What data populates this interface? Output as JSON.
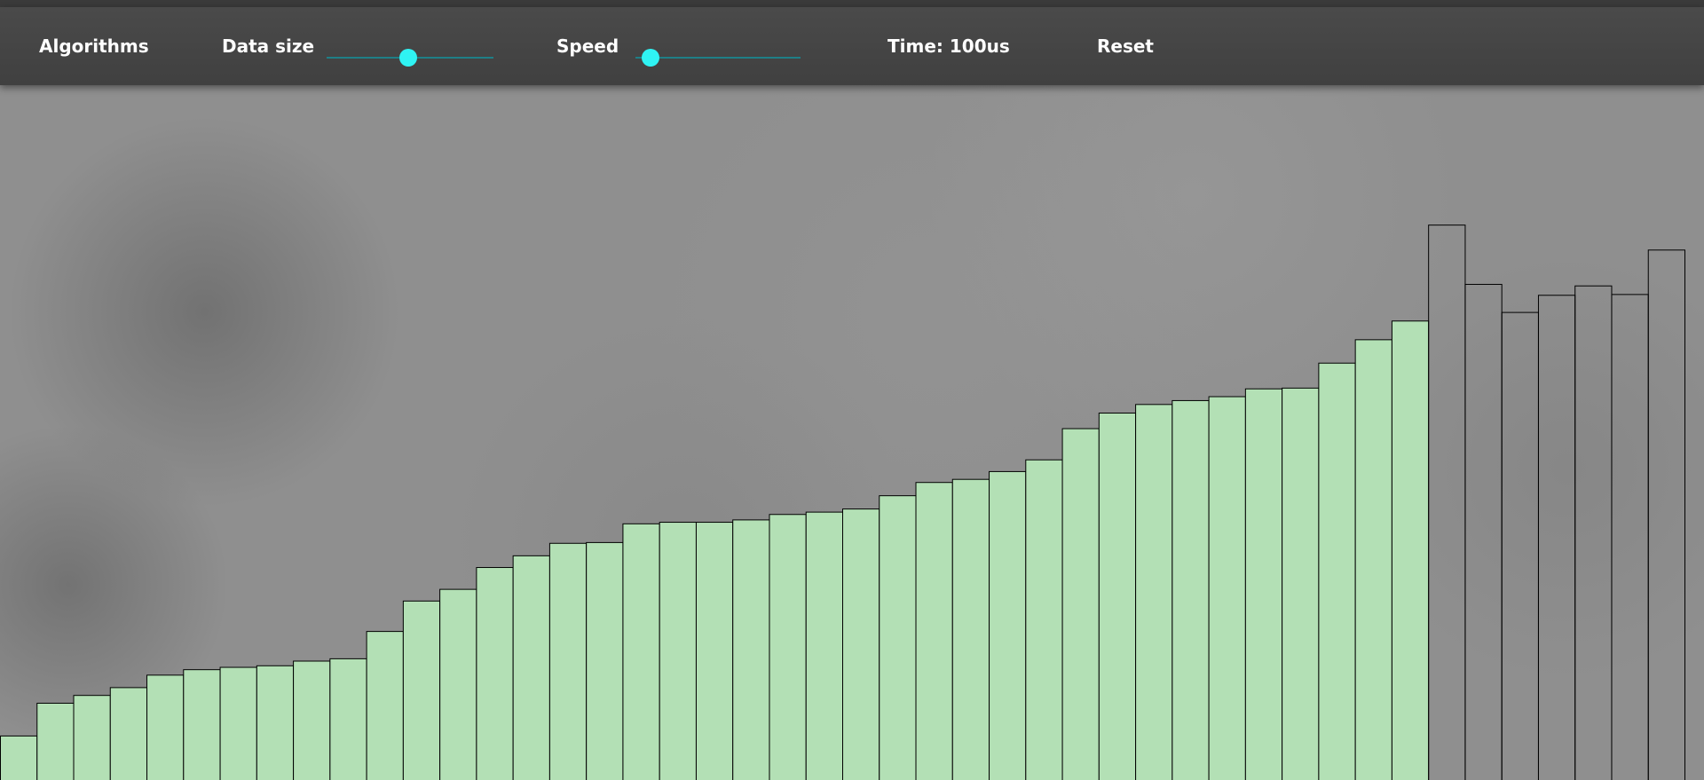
{
  "navbar": {
    "algorithms_label": "Algorithms",
    "data_size_label": "Data size",
    "speed_label": "Speed",
    "time_label": "Time: 100us",
    "reset_label": "Reset",
    "data_size_slider": {
      "value": 0.49
    },
    "speed_slider": {
      "value": 0.09
    }
  },
  "colors": {
    "sorted_bar_fill": "#b3e0b5",
    "unsorted_bar_fill": "transparent",
    "bar_stroke": "#000000",
    "slider_thumb": "#2ff3f3",
    "slider_track": "#1f7f86"
  },
  "chart_data": {
    "type": "bar",
    "ylim": [
      0,
      1
    ],
    "sorted_count": 39,
    "values": [
      0.057,
      0.099,
      0.109,
      0.119,
      0.135,
      0.142,
      0.145,
      0.147,
      0.153,
      0.156,
      0.191,
      0.23,
      0.245,
      0.273,
      0.288,
      0.304,
      0.305,
      0.329,
      0.331,
      0.331,
      0.334,
      0.341,
      0.344,
      0.348,
      0.365,
      0.382,
      0.386,
      0.396,
      0.411,
      0.451,
      0.471,
      0.482,
      0.487,
      0.492,
      0.502,
      0.503,
      0.535,
      0.565,
      0.589,
      0.712,
      0.636,
      0.6,
      0.622,
      0.634,
      0.623,
      0.68
    ]
  }
}
